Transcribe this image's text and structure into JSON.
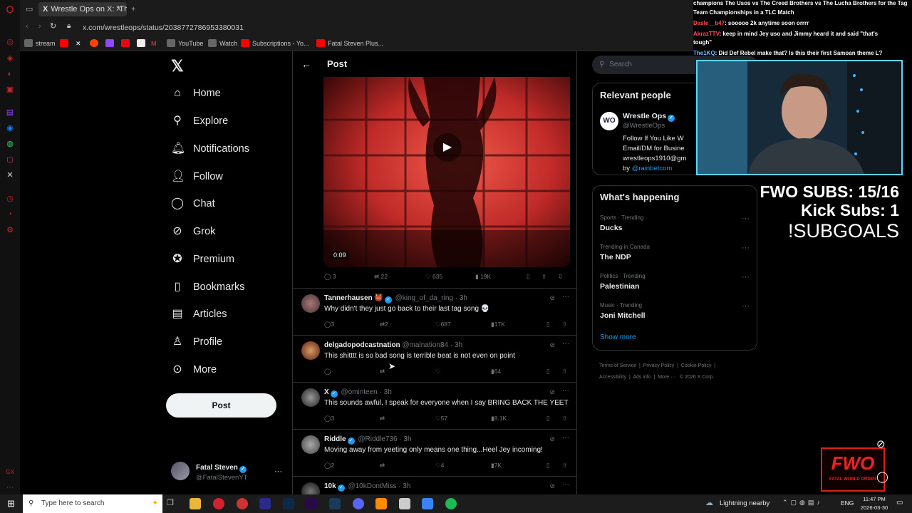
{
  "browser": {
    "tab_title": "Wrestle Ops on X: \"The Us",
    "url": "x.com/wrestleops/status/2038772786953380031",
    "bookmarks": [
      "stream",
      "YouTube",
      "Watch",
      "Subscriptions - Yo...",
      "Fatal Steven Plus..."
    ]
  },
  "nav": {
    "items": [
      "Home",
      "Explore",
      "Notifications",
      "Follow",
      "Chat",
      "Grok",
      "Premium",
      "Bookmarks",
      "Articles",
      "Profile",
      "More"
    ],
    "post_label": "Post",
    "account_name": "Fatal Steven",
    "account_handle": "@FatalStevenYT"
  },
  "header": {
    "title": "Post"
  },
  "video": {
    "time": "0:09",
    "stats": {
      "replies": "3",
      "reposts": "22",
      "likes": "635",
      "views": "19K"
    }
  },
  "replies": [
    {
      "name": "Tannerhausen 👹",
      "handle": "@king_of_da_ring · 3h",
      "text": "Why didn't they just go back to their last tag song 💀",
      "replies": "3",
      "reposts": "2",
      "likes": "687",
      "views": "17K"
    },
    {
      "name": "delgadopodcastnation",
      "handle": "@malnation84 · 3h",
      "text": "This shitttt is so bad song is terrible beat is not even on point",
      "replies": "",
      "reposts": "",
      "likes": "",
      "views": "64"
    },
    {
      "name": "X",
      "handle": "@ominteen · 3h",
      "text": "This sounds awful, I speak for everyone when I say BRING BACK THE YEET",
      "replies": "3",
      "reposts": "",
      "likes": "57",
      "views": "8.1K"
    },
    {
      "name": "Riddle",
      "handle": "@Riddle736 · 3h",
      "text": "Moving away from yeeting only means one thing...Heel Jey incoming!",
      "replies": "2",
      "reposts": "",
      "likes": "4",
      "views": "7K"
    },
    {
      "name": "10k",
      "handle": "@10kDontMiss · 3h",
      "text": "",
      "replies": "",
      "reposts": "",
      "likes": "",
      "views": ""
    }
  ],
  "search": {
    "placeholder": "Search"
  },
  "relevant": {
    "title": "Relevant people",
    "name": "Wrestle Ops",
    "handle": "@WrestleOps",
    "bio1": "Follow If You Like W",
    "bio2": "Email/DM for Busine",
    "bio3": "wrestleops1910@gm",
    "bio4_prefix": "by",
    "bio4_link": "@rainbetcom"
  },
  "happening": {
    "title": "What's happening",
    "trends": [
      {
        "meta": "Sports · Trending",
        "name": "Ducks"
      },
      {
        "meta": "Trending in Canada",
        "name": "The NDP"
      },
      {
        "meta": "Politics · Trending",
        "name": "Palestinian"
      },
      {
        "meta": "Music · Trending",
        "name": "Joni Mitchell"
      }
    ],
    "show_more": "Show more"
  },
  "footer": {
    "line1": [
      "Terms of Service",
      "Privacy Policy",
      "Cookie Policy"
    ],
    "line2": [
      "Accessibility",
      "Ads info",
      "More ···",
      "© 2026 X Corp."
    ]
  },
  "overlay": {
    "chat": [
      {
        "user": "",
        "text": "champions The Usos vs The Creed Brothers vs The Lucha Brothers for the Tag"
      },
      {
        "user": "",
        "text": "Team Championships in a TLC Match"
      },
      {
        "user": "Dasle__b47",
        "text": ": sooooo 2k anytime soon orrrr"
      },
      {
        "user": "AkrazTTV",
        "text": ": keep in mind Jey uso and Jimmy heard it and said \"that's"
      },
      {
        "user": "",
        "text": "tough\""
      },
      {
        "user": "The1KQ",
        "text": ": Did Def Rebel make that? Is this their first Samoan theme L?"
      }
    ],
    "fwo_subs": "FWO SUBS: 15/16",
    "kick_subs": "Kick Subs: 1",
    "subgoals": "!SUBGOALS",
    "logo_text": "FWO",
    "logo_sub": "FATAL WORLD ORDER"
  },
  "taskbar": {
    "search_placeholder": "Type here to search",
    "weather": "Lightning nearby",
    "lang": "ENG",
    "time": "11:47 PM",
    "date": "2026-03-30"
  },
  "colors": {
    "x_blue": "#1d9bf0",
    "opera_red": "#d2222d",
    "video_red": "#e0403a"
  }
}
